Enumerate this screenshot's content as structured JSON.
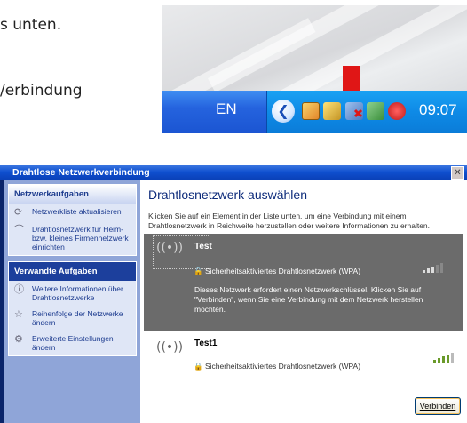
{
  "doc": {
    "line1": "s unten.",
    "line2": "/erbindung"
  },
  "taskbar": {
    "language": "EN",
    "clock": "09:07",
    "chevron_glyph": "❮"
  },
  "dialog": {
    "title": "Drahtlose Netzwerkverbindung",
    "close_glyph": "✕",
    "left_pane": {
      "network_tasks_title": "Netzwerkaufgaben",
      "network_tasks": [
        {
          "label": "Netzwerkliste aktualisieren",
          "icon": "refresh-icon"
        },
        {
          "label": "Drahtlosnetzwerk für Heim- bzw. kleines Firmennetzwerk einrichten",
          "icon": "network-setup-icon"
        }
      ],
      "related_tasks_title": "Verwandte Aufgaben",
      "related_tasks": [
        {
          "label": "Weitere Informationen über Drahtlosnetzwerke",
          "icon": "info-icon"
        },
        {
          "label": "Reihenfolge der Netzwerke ändern",
          "icon": "star-icon"
        },
        {
          "label": "Erweiterte Einstellungen ändern",
          "icon": "settings-icon"
        }
      ]
    },
    "main": {
      "title": "Drahtlosnetzwerk auswählen",
      "description": "Klicken Sie auf ein Element in der Liste unten, um eine Verbindung mit einem Drahtlosnetzwerk in Reichweite herzustellen oder weitere Informationen zu erhalten.",
      "networks": [
        {
          "name": "Test",
          "security": "Sicherheitsaktiviertes Drahtlosnetzwerk (WPA)",
          "message": "Dieses Netzwerk erfordert einen Netzwerkschlüssel. Klicken Sie auf \"Verbinden\", wenn Sie eine Verbindung mit dem Netzwerk herstellen möchten.",
          "signal": 0.6,
          "selected": true
        },
        {
          "name": "Test1",
          "security": "Sicherheitsaktiviertes Drahtlosnetzwerk (WPA)",
          "signal": 0.8,
          "selected": false
        }
      ],
      "connect_button": "Verbinden"
    }
  },
  "colors": {
    "xp_blue": "#0f4fcf",
    "arrow_red": "#e01616",
    "selected_row": "#6b6b6b"
  }
}
